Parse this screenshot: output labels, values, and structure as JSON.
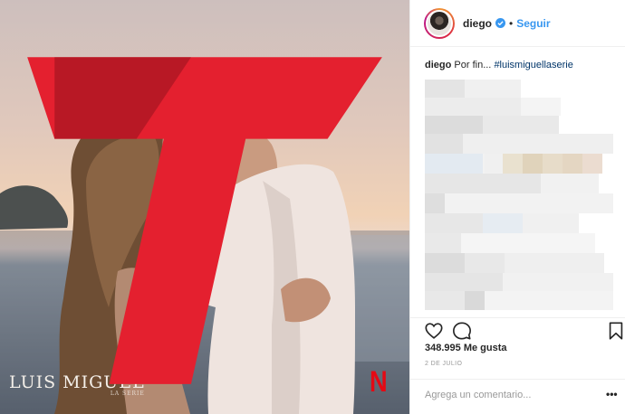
{
  "post": {
    "photo_alt": "Luis Miguel serie kiss scene on beach",
    "watermark_left": "LUIS MIGUEL",
    "watermark_left_sub": "LA SERIE",
    "watermark_netflix": "N"
  },
  "header": {
    "username": "diego",
    "separator": "•",
    "follow_label": "Seguir"
  },
  "caption": {
    "username": "diego",
    "text": "Por fin...",
    "hashtag": "#luismiguellaserie"
  },
  "actions": {
    "likes": "348.995 Me gusta",
    "date": "2 DE JULIO"
  },
  "comment": {
    "placeholder": "Agrega un comentario...",
    "more": "•••"
  },
  "colors": {
    "link_blue": "#3897f0",
    "hashtag": "#003569",
    "netflix_red": "#e50914",
    "telemundo_red": "#e4202f"
  },
  "icons": [
    "verified-icon",
    "heart-icon",
    "comment-icon",
    "bookmark-icon",
    "telemundo-logo-icon",
    "more-options-icon"
  ]
}
